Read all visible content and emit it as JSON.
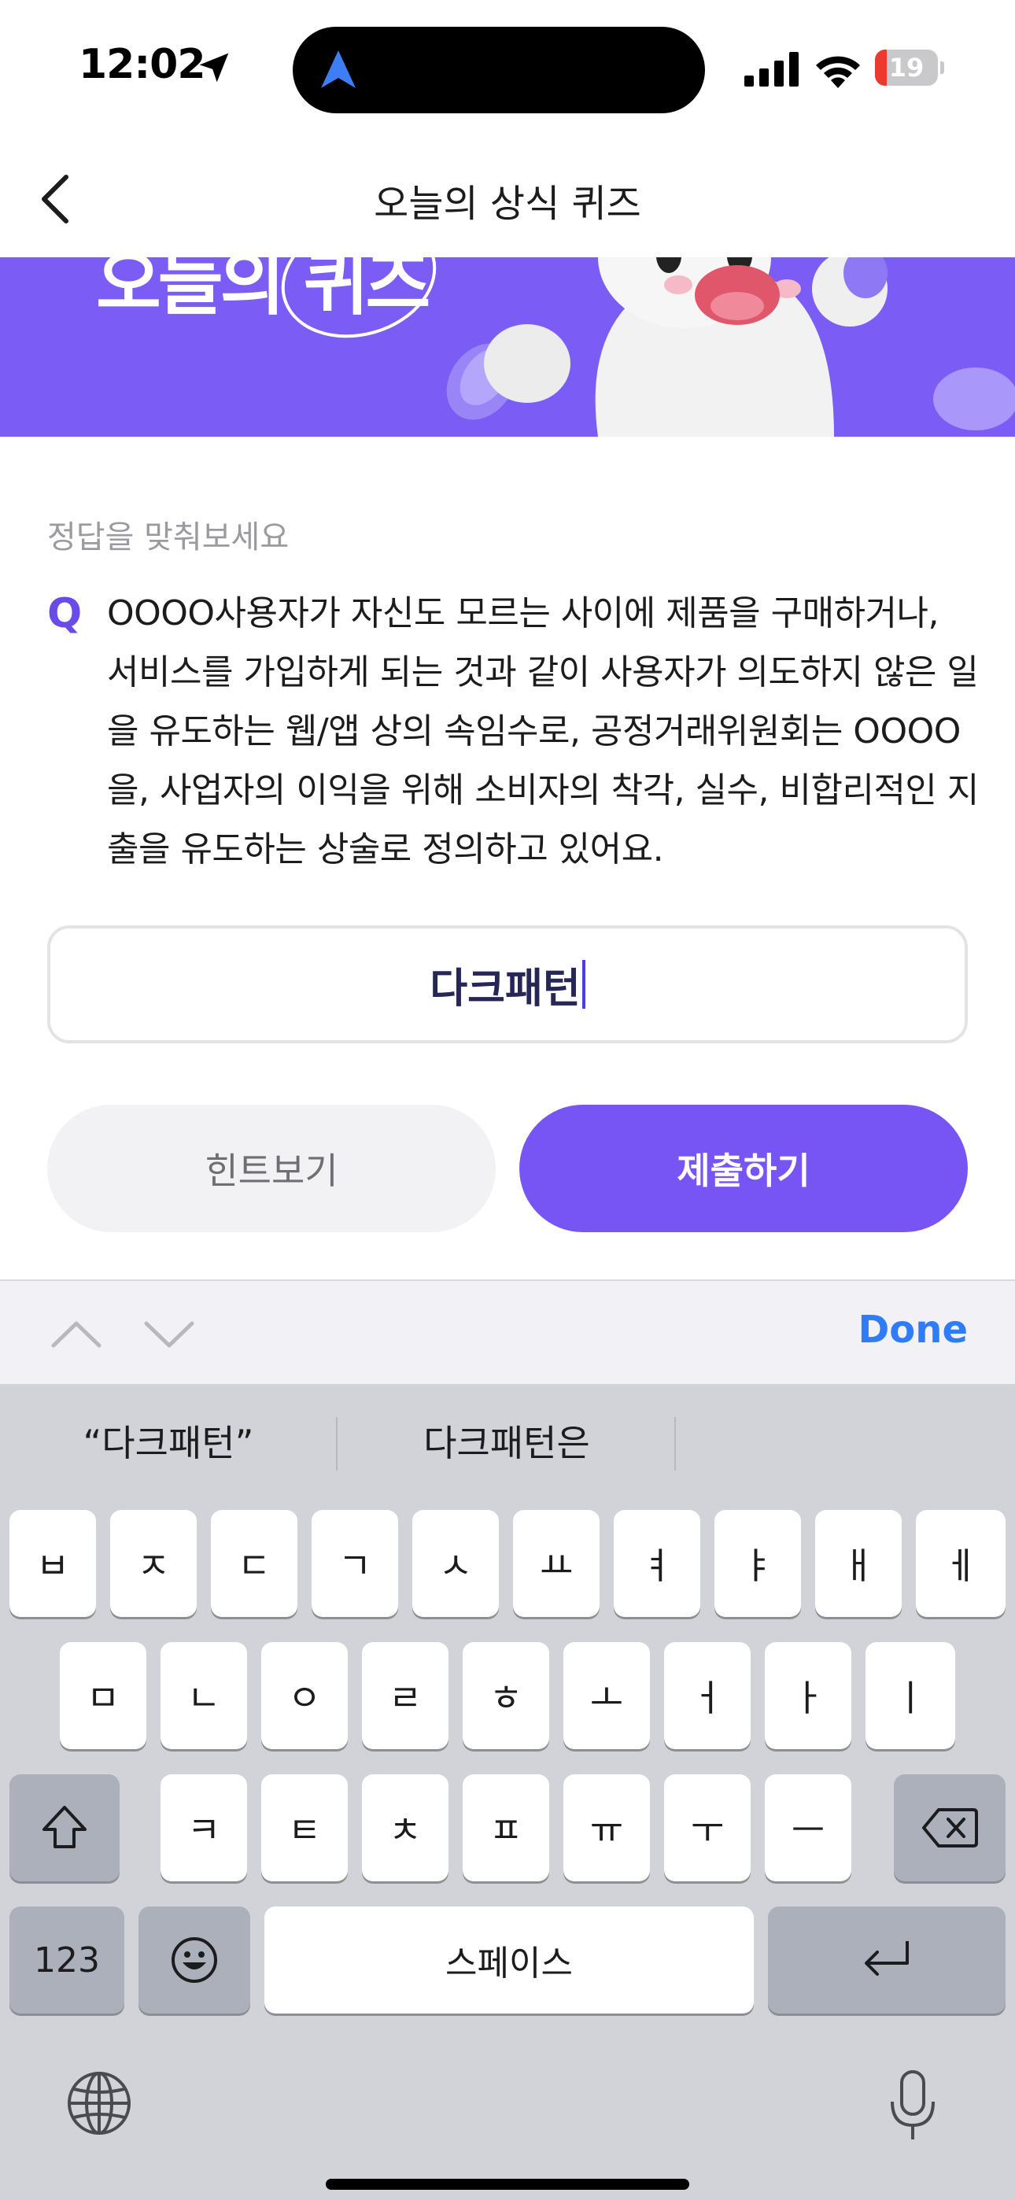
{
  "status_bar": {
    "time": "12:02",
    "battery": "19",
    "battery_level": 0.19
  },
  "nav": {
    "title": "오늘의 상식 퀴즈",
    "back_icon": "chevron-left-icon"
  },
  "banner": {
    "title": "오늘의 퀴즈",
    "background": "#7b5cf5"
  },
  "quiz": {
    "prompt": "정답을 맞춰보세요",
    "q_mark": "Q",
    "question": "OOOO사용자가 자신도 모르는 사이에 제품을 구매하거나, 서비스를 가입하게 되는 것과 같이 사용자가 의도하지 않은 일을 유도하는 웹/앱 상의 속임수로, 공정거래위원회는 OOOO을, 사업자의 이익을 위해 소비자의 착각, 실수, 비합리적인 지출을 유도하는 상술로 정의하고 있어요.",
    "answer_value": "다크패턴",
    "hint_label": "힌트보기",
    "submit_label": "제출하기",
    "accent": "#7755f5"
  },
  "accessory": {
    "done_label": "Done",
    "up_icon": "chevron-up-icon",
    "down_icon": "chevron-down-icon"
  },
  "keyboard": {
    "suggestions": [
      "“다크패턴”",
      "다크패턴은"
    ],
    "row1": [
      "ㅂ",
      "ㅈ",
      "ㄷ",
      "ㄱ",
      "ㅅ",
      "ㅛ",
      "ㅕ",
      "ㅑ",
      "ㅐ",
      "ㅔ"
    ],
    "row2": [
      "ㅁ",
      "ㄴ",
      "ㅇ",
      "ㄹ",
      "ㅎ",
      "ㅗ",
      "ㅓ",
      "ㅏ",
      "ㅣ"
    ],
    "row3": [
      "ㅋ",
      "ㅌ",
      "ㅊ",
      "ㅍ",
      "ㅠ",
      "ㅜ",
      "ㅡ"
    ],
    "numbers_label": "123",
    "space_label": "스페이스",
    "icons": [
      "shift-icon",
      "backspace-icon",
      "emoji-icon",
      "return-icon",
      "globe-icon",
      "microphone-icon"
    ]
  }
}
